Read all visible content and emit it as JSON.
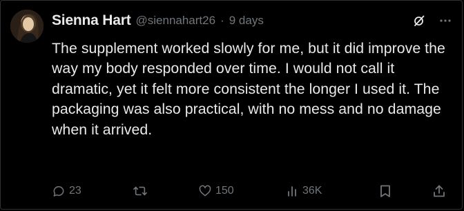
{
  "author": {
    "name": "Sienna Hart",
    "handle": "@siennahart26",
    "separator": "·",
    "time": "9 days"
  },
  "tweet": {
    "text": "The supplement worked slowly for me, but it did improve the way my body responded over time. I would not call it dramatic, yet it felt more consistent the longer I used it. The packaging was also practical, with no mess and no damage when it arrived."
  },
  "actions": {
    "replies": "23",
    "retweets": "",
    "likes": "150",
    "views": "36K"
  },
  "icons": {
    "header": [
      "grok-icon",
      "more-icon"
    ],
    "actions": [
      "reply-icon",
      "retweet-icon",
      "like-icon",
      "views-icon",
      "bookmark-icon",
      "share-icon"
    ]
  },
  "colors": {
    "background": "#000000",
    "text": "#e7e9ea",
    "muted": "#71767b",
    "border": "#2f3336"
  }
}
